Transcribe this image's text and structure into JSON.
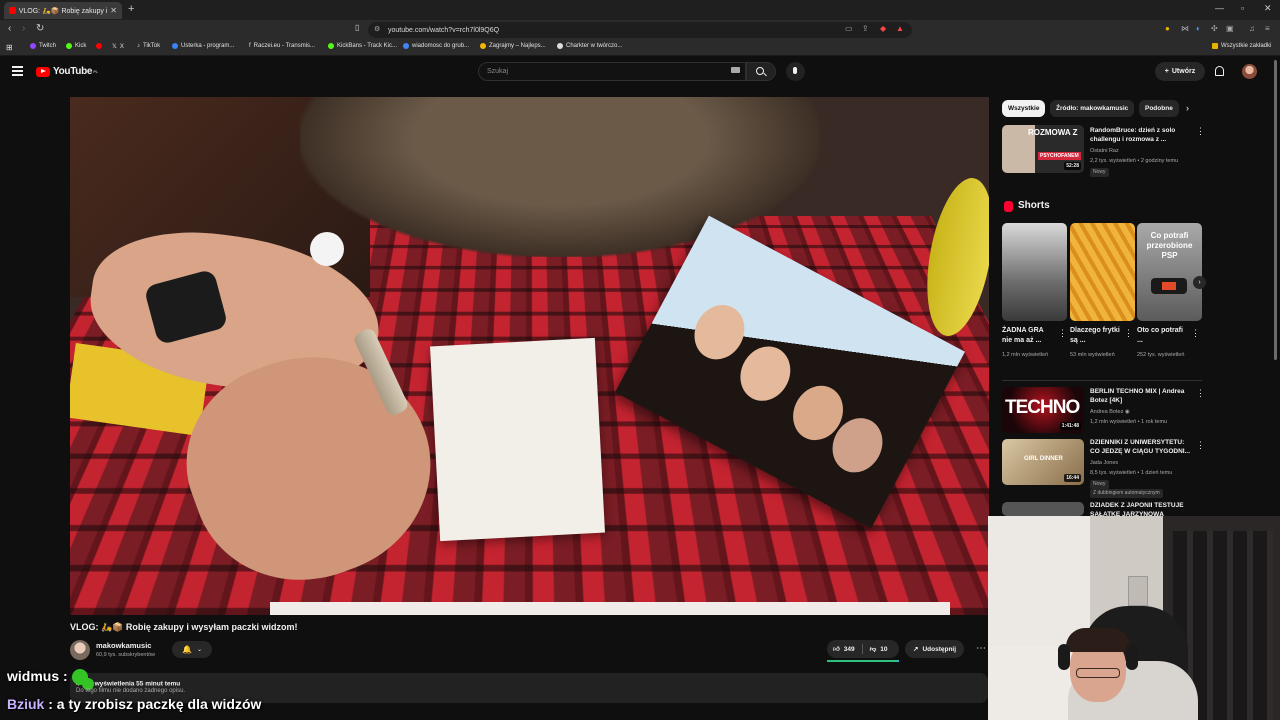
{
  "browser": {
    "tab_title": "VLOG: 🛵📦 Robię zakupy i wys",
    "url": "youtube.com/watch?v=rch7l0l9Q6Q",
    "bookmarks": [
      "Twitch",
      "Kick",
      "X",
      "TikTok",
      "Usterka - program...",
      "Raczei.eu - Transmis...",
      "KickBans - Track Kic...",
      "wiadomosc do grub...",
      "Zagrajmy – Najleps...",
      "Charkter w twórczo..."
    ],
    "all_bookmarks": "Wszystkie zakładki"
  },
  "youtube": {
    "logo": "YouTube",
    "country": "PL",
    "search_placeholder": "Szukaj",
    "create_label": "Utwórz"
  },
  "video": {
    "title": "VLOG: 🛵📦 Robię zakupy i wysyłam paczki widzom!",
    "channel": "makowkamusic",
    "subscribers": "60,9 tys. subskrybentów",
    "likes": "349",
    "dislikes": "10",
    "share_label": "Udostępnij",
    "views_prefix": "4",
    "views_suffix": "wyświetlenia  55 minut temu",
    "description": "Do tego filmu nie dodano żadnego opisu.",
    "like_ratio": 0.97
  },
  "chat": [
    {
      "user": "widmus",
      "sep": " :",
      "text": ""
    },
    {
      "user": "Bziuk",
      "sep": " :",
      "text": " a ty zrobisz paczkę dla widzów"
    }
  ],
  "sidebar": {
    "chips": [
      "Wszystkie",
      "Źródło: makowkamusic",
      "Podobne"
    ],
    "top_video": {
      "title": "RandomBruce: dzień z solo challengu i rozmowa z ...",
      "channel": "Ostatni Raz",
      "meta": "2,2 tys. wyświetleń • 2 godziny temu",
      "badge": "Nowy",
      "duration": "52:28",
      "thumb_text1": "ROZMOWA Z",
      "thumb_text2": "PSYCHOFANEM"
    },
    "shorts_title": "Shorts",
    "shorts": [
      {
        "title": "ŻADNA GRA nie ma aż ...",
        "views": "1,2 mln wyświetleń"
      },
      {
        "title": "Dlaczego frytki są ...",
        "views": "53 mln wyświetleń"
      },
      {
        "title": "Oto co potrafi ...",
        "views": "252 tys. wyświetleń",
        "thumb_text": "Co potrafi przerobione PSP"
      }
    ],
    "videos": [
      {
        "title": "BERLIN TECHNO MIX | Andrea Botez [4K]",
        "channel": "Andrea Botez",
        "meta": "1,2 mln wyświetleń • 1 rok temu",
        "duration": "1:41:48",
        "thumb_text": "TECHNO"
      },
      {
        "title": "DZIENNIKI Z UNIWERSYTETU: CO JEDZĘ W CIĄGU TYGODNI...",
        "channel": "Jada Jones",
        "meta": "8,5 tys. wyświetleń • 1 dzień temu",
        "badge": "Nowy",
        "badge2": "Z dubbingiem automatycznym",
        "duration": "16:44",
        "thumb_text": "GIRL DINNER"
      },
      {
        "title": "DZIADEK Z JAPONII TESTUJE SAŁATKĘ JARZYNOWĄ",
        "channel": "",
        "meta": ""
      }
    ]
  },
  "colors": {
    "accent_red": "#ff0000",
    "like_green": "#2ec27e",
    "chat_user": "#c8b3ff"
  }
}
